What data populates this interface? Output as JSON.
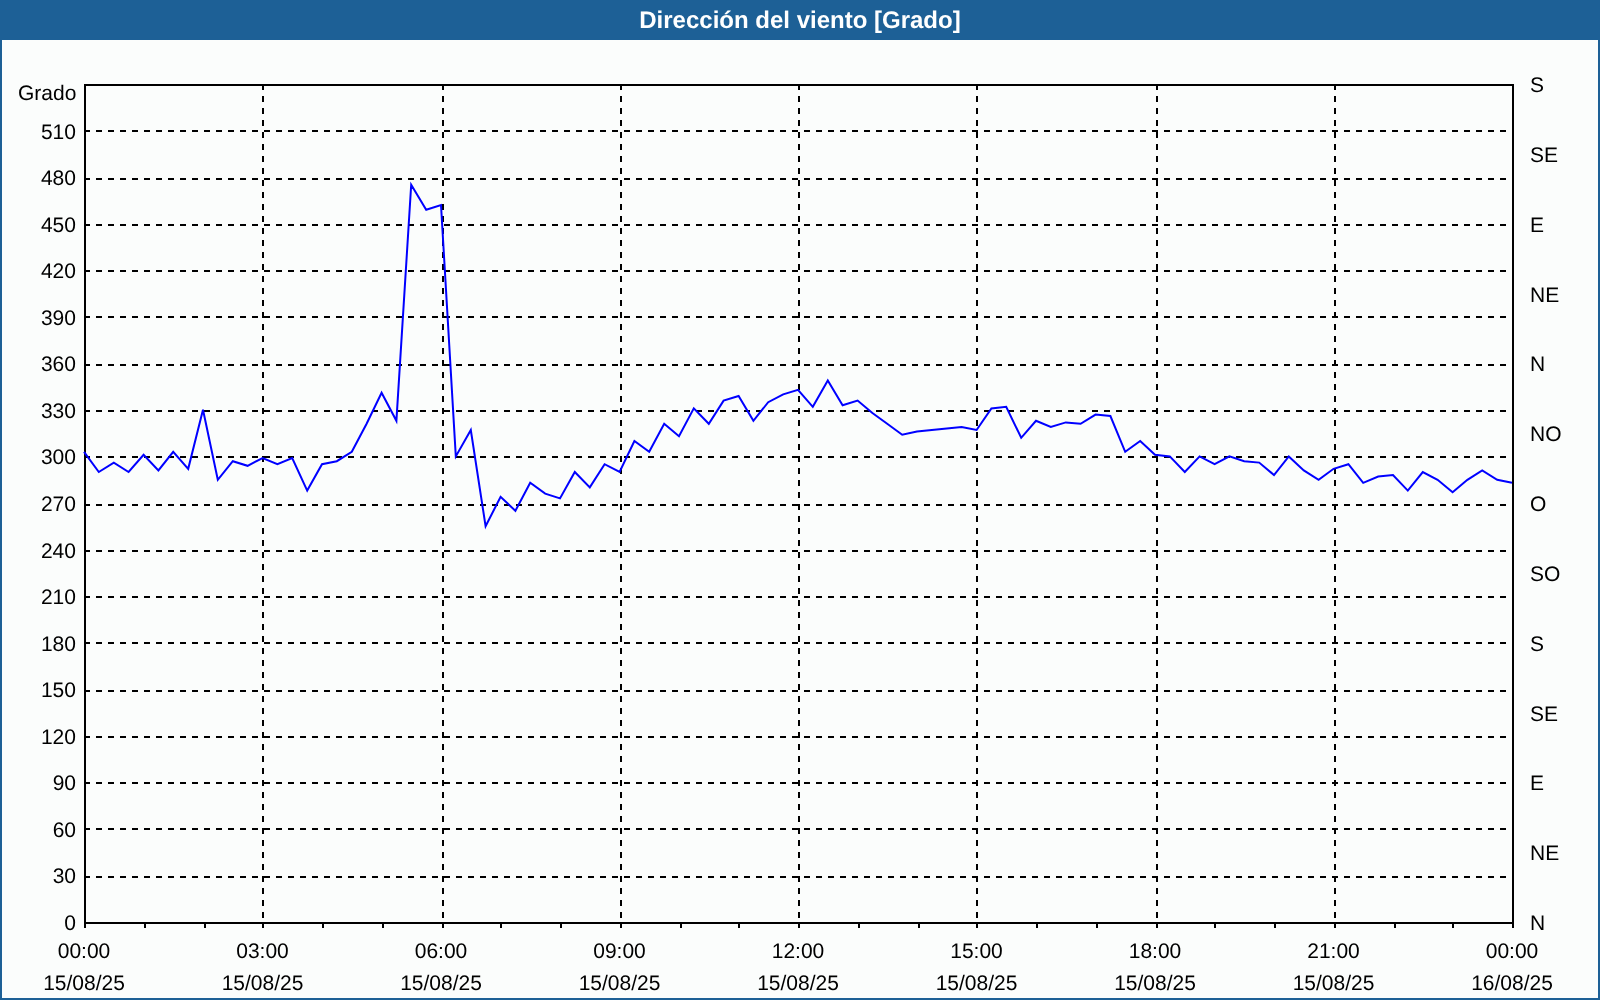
{
  "window": {
    "title": "Dirección del viento [Grado]"
  },
  "chart": {
    "chart_data": {
      "type": "line",
      "ylabel": "Grado",
      "ylim": [
        0,
        540
      ],
      "yticks": [
        0,
        30,
        60,
        90,
        120,
        150,
        180,
        210,
        240,
        270,
        300,
        330,
        360,
        390,
        420,
        450,
        480,
        510
      ],
      "categories": [
        "00:00\n15/08/25",
        null,
        null,
        null,
        null,
        null,
        null,
        null,
        null,
        null,
        null,
        null,
        "03:00\n15/08/25",
        null,
        null,
        null,
        null,
        null,
        null,
        null,
        null,
        null,
        null,
        null,
        "06:00\n15/08/25",
        null,
        null,
        null,
        null,
        null,
        null,
        null,
        null,
        null,
        null,
        null,
        "09:00\n15/08/25",
        null,
        null,
        null,
        null,
        null,
        null,
        null,
        null,
        null,
        null,
        null,
        "12:00\n15/08/25",
        null,
        null,
        null,
        null,
        null,
        null,
        null,
        null,
        null,
        null,
        null,
        "15:00\n15/08/25",
        null,
        null,
        null,
        null,
        null,
        null,
        null,
        null,
        null,
        null,
        null,
        "18:00\n15/08/25",
        null,
        null,
        null,
        null,
        null,
        null,
        null,
        null,
        null,
        null,
        null,
        "21:00\n15/08/25",
        null,
        null,
        null,
        null,
        null,
        null,
        null,
        null,
        null,
        null,
        null,
        "00:00\n16/08/25"
      ],
      "grid": true,
      "annotations": [
        "S",
        "SE",
        "E",
        "NE",
        "N",
        "NO",
        "O",
        "SO",
        "S",
        "SE",
        "E",
        "NE",
        "N"
      ],
      "series": [
        {
          "color": "#0000ff",
          "values": [
            303,
            290,
            296,
            290,
            301,
            291,
            303,
            292,
            330,
            285,
            297,
            294,
            299,
            295,
            299,
            278,
            295,
            297,
            303,
            321,
            341,
            323,
            475,
            459,
            462,
            300,
            317,
            255,
            274,
            265,
            283,
            276,
            273,
            290,
            280,
            295,
            290,
            310,
            303,
            321,
            313,
            331,
            321,
            336,
            339,
            323,
            335,
            340,
            343,
            332,
            349,
            333,
            336,
            328,
            321,
            314,
            316,
            317,
            318,
            319,
            317,
            331,
            332,
            312,
            323,
            319,
            322,
            321,
            327,
            326,
            303,
            310,
            301,
            300,
            290,
            300,
            295,
            300,
            297,
            296,
            288,
            300,
            291,
            285,
            292,
            295,
            283,
            287,
            288,
            278,
            290,
            285,
            277,
            285,
            291,
            285,
            283
          ]
        }
      ]
    }
  }
}
